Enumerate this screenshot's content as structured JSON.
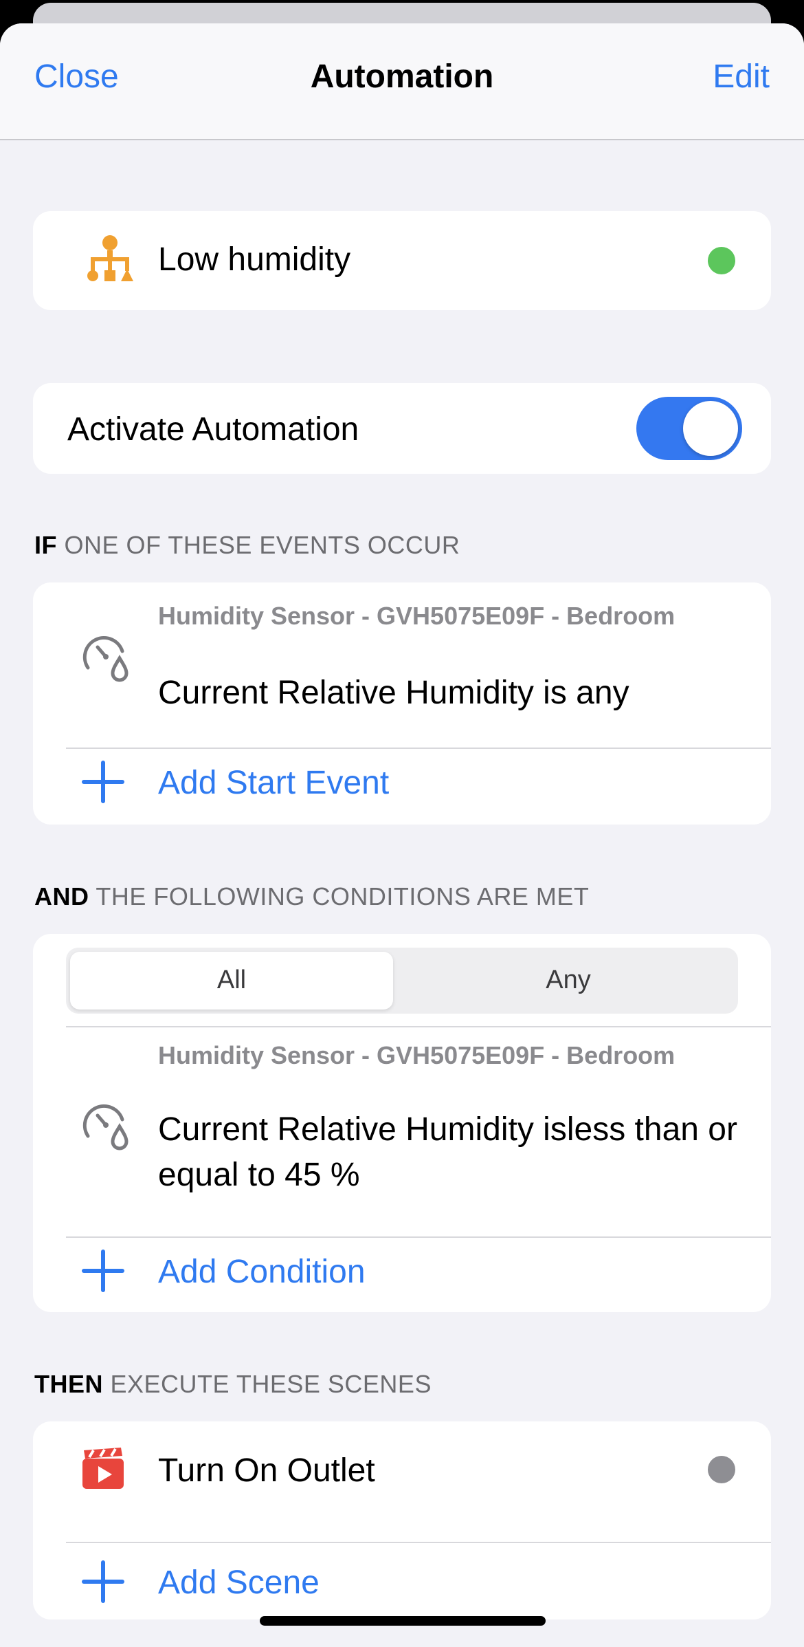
{
  "nav": {
    "close": "Close",
    "title": "Automation",
    "edit": "Edit"
  },
  "automation": {
    "name": "Low humidity",
    "status_color": "#5cc65c",
    "icon": "automation-icon"
  },
  "activate": {
    "label": "Activate Automation",
    "enabled": true
  },
  "if_section": {
    "keyword": "IF",
    "header": " ONE OF THESE EVENTS OCCUR",
    "event": {
      "icon": "humidity-sensor-icon",
      "device": "Humidity Sensor - GVH5075E09F - Bedroom",
      "description": "Current Relative Humidity is any"
    },
    "add_label": "Add Start Event"
  },
  "and_section": {
    "keyword": "AND",
    "header": " THE FOLLOWING CONDITIONS ARE MET",
    "segment": {
      "options": [
        "All",
        "Any"
      ],
      "selected": "All"
    },
    "condition": {
      "icon": "humidity-sensor-icon",
      "device": "Humidity Sensor - GVH5075E09F - Bedroom",
      "description": "Current Relative Humidity isless than or equal to 45 %"
    },
    "add_label": "Add Condition"
  },
  "then_section": {
    "keyword": "THEN",
    "header": " EXECUTE THESE SCENES",
    "scene": {
      "icon": "scene-icon",
      "name": "Turn On Outlet",
      "status_color": "#8e8e93"
    },
    "add_label": "Add Scene"
  }
}
